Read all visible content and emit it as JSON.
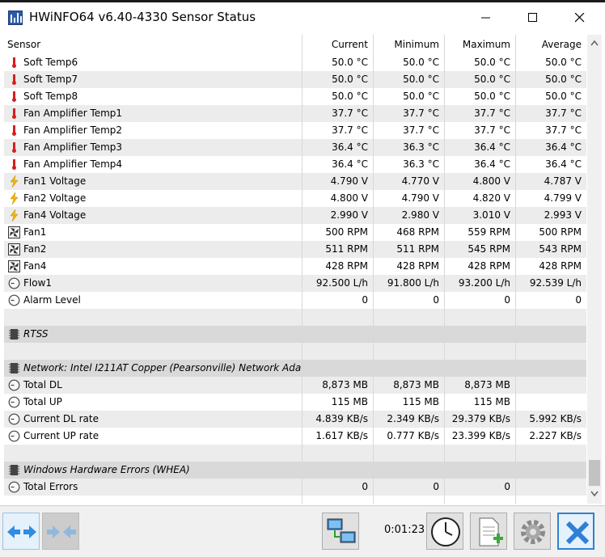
{
  "window": {
    "title": "HWiNFO64 v6.40-4330 Sensor Status"
  },
  "columns": {
    "sensor": "Sensor",
    "current": "Current",
    "minimum": "Minimum",
    "maximum": "Maximum",
    "average": "Average"
  },
  "rows": [
    {
      "type": "item",
      "icon": "thermometer-icon",
      "name": "Soft Temp6",
      "current": "50.0 °C",
      "minimum": "50.0 °C",
      "maximum": "50.0 °C",
      "average": "50.0 °C"
    },
    {
      "type": "item",
      "icon": "thermometer-icon",
      "name": "Soft Temp7",
      "current": "50.0 °C",
      "minimum": "50.0 °C",
      "maximum": "50.0 °C",
      "average": "50.0 °C"
    },
    {
      "type": "item",
      "icon": "thermometer-icon",
      "name": "Soft Temp8",
      "current": "50.0 °C",
      "minimum": "50.0 °C",
      "maximum": "50.0 °C",
      "average": "50.0 °C"
    },
    {
      "type": "item",
      "icon": "thermometer-icon",
      "name": "Fan Amplifier Temp1",
      "current": "37.7 °C",
      "minimum": "37.7 °C",
      "maximum": "37.7 °C",
      "average": "37.7 °C"
    },
    {
      "type": "item",
      "icon": "thermometer-icon",
      "name": "Fan Amplifier Temp2",
      "current": "37.7 °C",
      "minimum": "37.7 °C",
      "maximum": "37.7 °C",
      "average": "37.7 °C"
    },
    {
      "type": "item",
      "icon": "thermometer-icon",
      "name": "Fan Amplifier Temp3",
      "current": "36.4 °C",
      "minimum": "36.3 °C",
      "maximum": "36.4 °C",
      "average": "36.4 °C"
    },
    {
      "type": "item",
      "icon": "thermometer-icon",
      "name": "Fan Amplifier Temp4",
      "current": "36.4 °C",
      "minimum": "36.3 °C",
      "maximum": "36.4 °C",
      "average": "36.4 °C"
    },
    {
      "type": "item",
      "icon": "lightning-icon",
      "name": "Fan1 Voltage",
      "current": "4.790 V",
      "minimum": "4.770 V",
      "maximum": "4.800 V",
      "average": "4.787 V"
    },
    {
      "type": "item",
      "icon": "lightning-icon",
      "name": "Fan2 Voltage",
      "current": "4.800 V",
      "minimum": "4.790 V",
      "maximum": "4.820 V",
      "average": "4.799 V"
    },
    {
      "type": "item",
      "icon": "lightning-icon",
      "name": "Fan4 Voltage",
      "current": "2.990 V",
      "minimum": "2.980 V",
      "maximum": "3.010 V",
      "average": "2.993 V"
    },
    {
      "type": "item",
      "icon": "fan-icon",
      "name": "Fan1",
      "current": "500 RPM",
      "minimum": "468 RPM",
      "maximum": "559 RPM",
      "average": "500 RPM"
    },
    {
      "type": "item",
      "icon": "fan-icon",
      "name": "Fan2",
      "current": "511 RPM",
      "minimum": "511 RPM",
      "maximum": "545 RPM",
      "average": "543 RPM"
    },
    {
      "type": "item",
      "icon": "fan-icon",
      "name": "Fan4",
      "current": "428 RPM",
      "minimum": "428 RPM",
      "maximum": "428 RPM",
      "average": "428 RPM"
    },
    {
      "type": "item",
      "icon": "gauge-icon",
      "name": "Flow1",
      "current": "92.500 L/h",
      "minimum": "91.800 L/h",
      "maximum": "93.200 L/h",
      "average": "92.539 L/h"
    },
    {
      "type": "item",
      "icon": "gauge-icon",
      "name": "Alarm Level",
      "current": "0",
      "minimum": "0",
      "maximum": "0",
      "average": "0"
    },
    {
      "type": "blank"
    },
    {
      "type": "group",
      "icon": "chip-icon",
      "name": "RTSS"
    },
    {
      "type": "blank"
    },
    {
      "type": "group",
      "icon": "chip-icon",
      "name": "Network: Intel I211AT Copper (Pearsonville) Network Ada..."
    },
    {
      "type": "item",
      "icon": "gauge-icon",
      "name": "Total DL",
      "current": "8,873 MB",
      "minimum": "8,873 MB",
      "maximum": "8,873 MB",
      "average": ""
    },
    {
      "type": "item",
      "icon": "gauge-icon",
      "name": "Total UP",
      "current": "115 MB",
      "minimum": "115 MB",
      "maximum": "115 MB",
      "average": ""
    },
    {
      "type": "item",
      "icon": "gauge-icon",
      "name": "Current DL rate",
      "current": "4.839 KB/s",
      "minimum": "2.349 KB/s",
      "maximum": "29.379 KB/s",
      "average": "5.992 KB/s"
    },
    {
      "type": "item",
      "icon": "gauge-icon",
      "name": "Current UP rate",
      "current": "1.617 KB/s",
      "minimum": "0.777 KB/s",
      "maximum": "23.399 KB/s",
      "average": "2.227 KB/s"
    },
    {
      "type": "blank"
    },
    {
      "type": "group",
      "icon": "chip-icon",
      "name": "Windows Hardware Errors (WHEA)"
    },
    {
      "type": "item",
      "icon": "gauge-icon",
      "name": "Total Errors",
      "current": "0",
      "minimum": "0",
      "maximum": "0",
      "average": ""
    },
    {
      "type": "blank"
    }
  ],
  "toolbar": {
    "timer": "0:01:23"
  },
  "colors": {
    "accent_blue": "#2f8de4",
    "close_button": "#2f7fd6",
    "group_row": "#d9d9d9",
    "alt_row": "#ececec"
  }
}
